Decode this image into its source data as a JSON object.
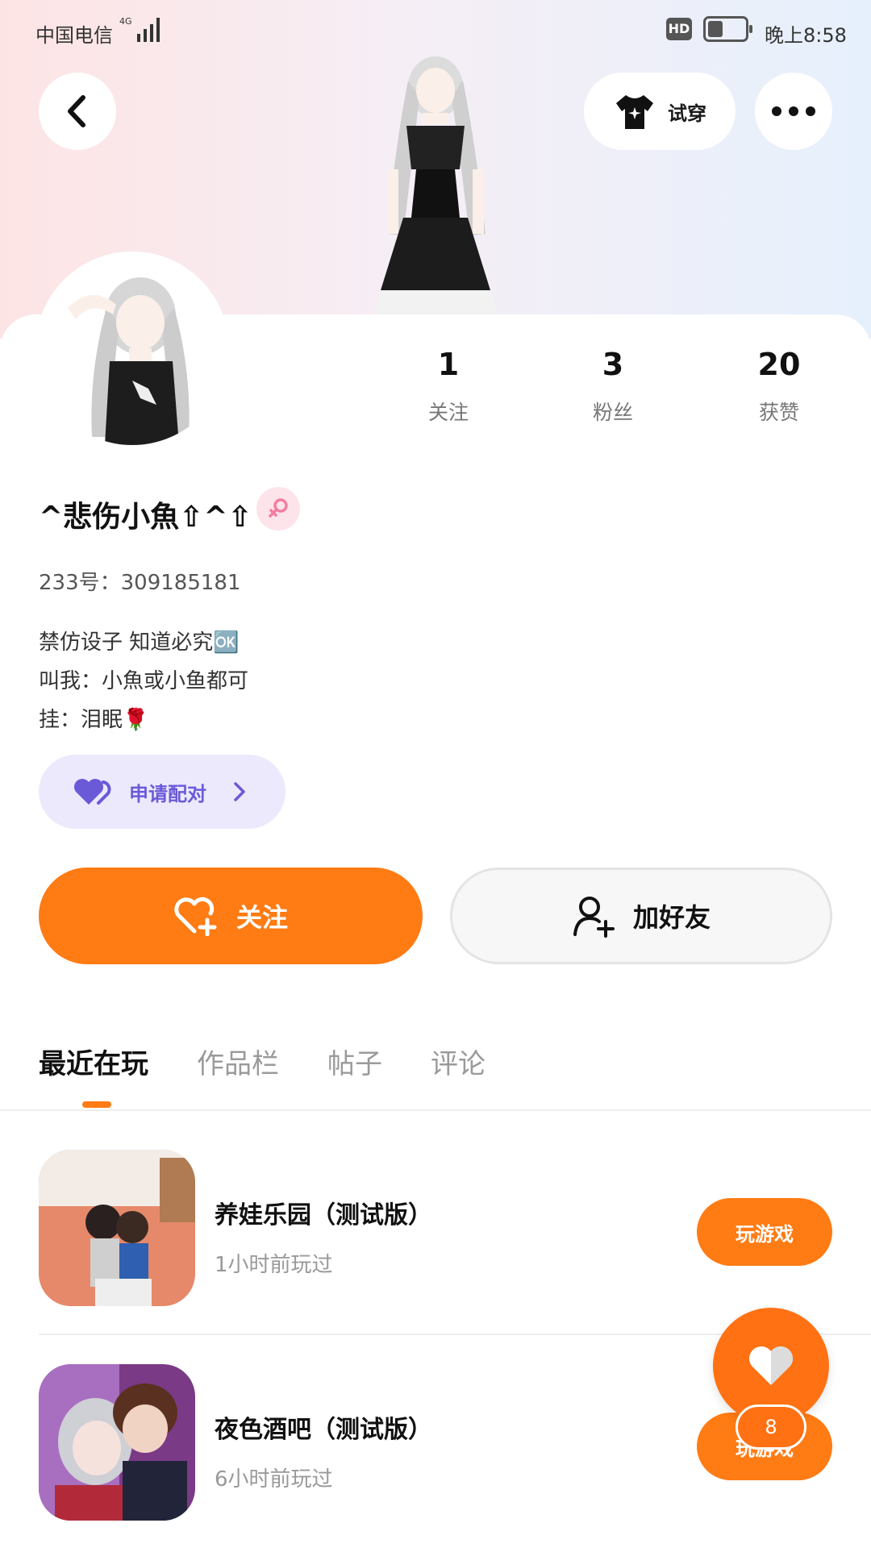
{
  "status_bar": {
    "carrier": "中国电信",
    "network": "4G",
    "hd": "HD",
    "time": "晚上8:58"
  },
  "header": {
    "try_on_label": "试穿"
  },
  "profile": {
    "name": "^悲伤小魚⇧^⇧",
    "uid": "233号：309185181",
    "bio_lines": [
      "禁仿设子 知道必究🆗",
      "叫我：小魚或小鱼都可",
      "挂：泪眠🌹"
    ],
    "stats": [
      {
        "value": "1",
        "label": "关注"
      },
      {
        "value": "3",
        "label": "粉丝"
      },
      {
        "value": "20",
        "label": "获赞"
      }
    ],
    "pair_label": "申请配对",
    "follow_label": "关注",
    "add_friend_label": "加好友"
  },
  "tabs": [
    "最近在玩",
    "作品栏",
    "帖子",
    "评论"
  ],
  "games": [
    {
      "title": "养娃乐园（测试版）",
      "played": "1小时前玩过",
      "button": "玩游戏"
    },
    {
      "title": "夜色酒吧（测试版）",
      "played": "6小时前玩过",
      "button": "玩游戏"
    }
  ],
  "fab": {
    "count": "8"
  },
  "colors": {
    "accent": "#ff7b14",
    "pair_bg": "#ece9fd",
    "pair_text": "#6a5ad8"
  }
}
